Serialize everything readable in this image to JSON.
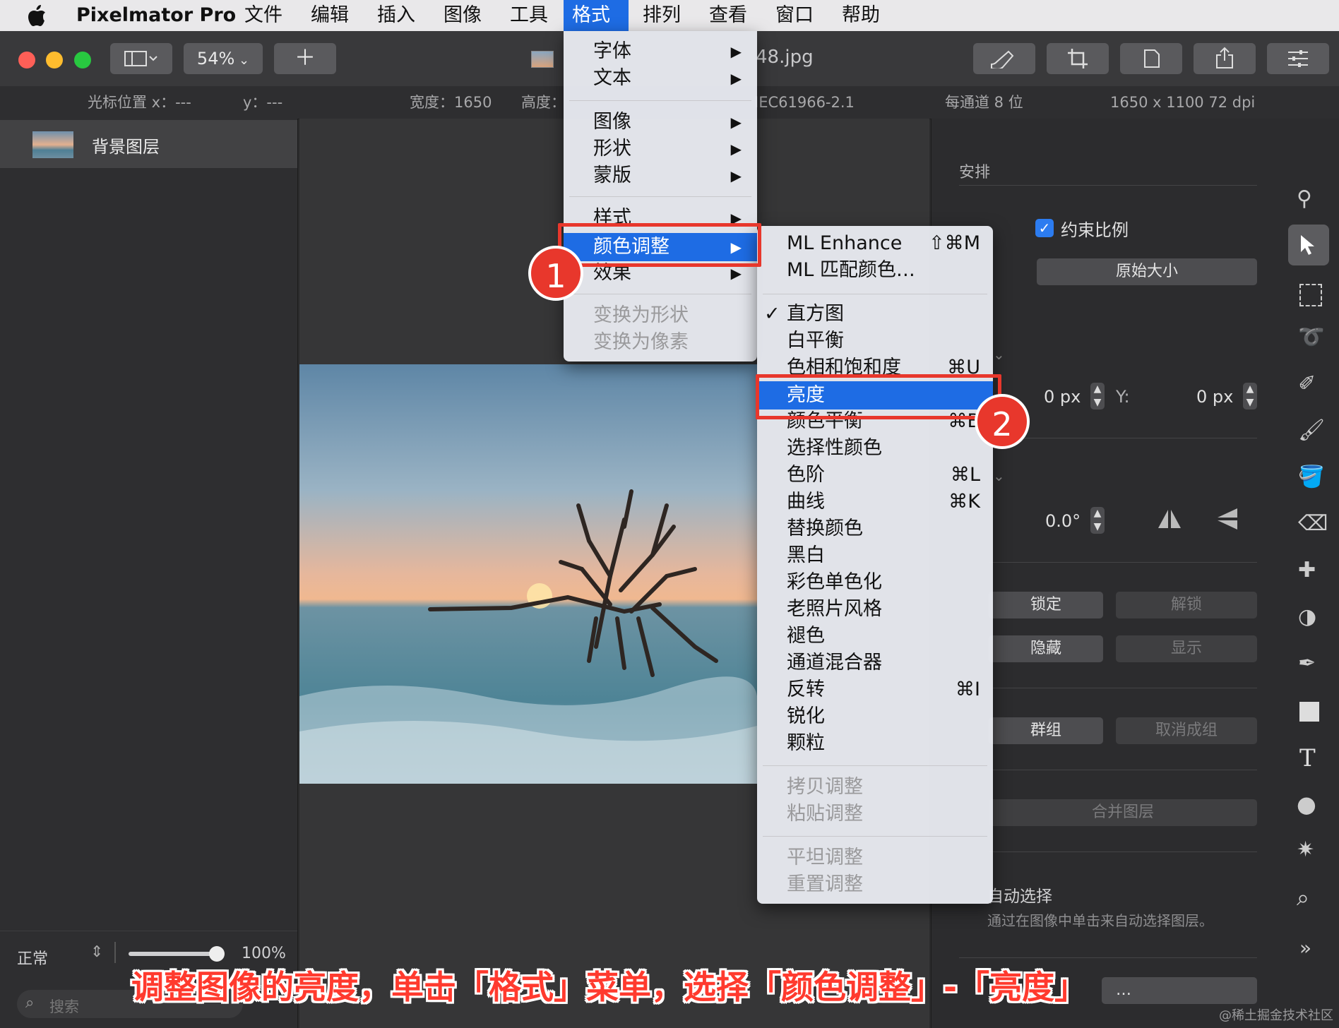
{
  "menubar": {
    "app_name": "Pixelmator Pro",
    "items": [
      "文件",
      "编辑",
      "插入",
      "图像",
      "工具",
      "格式",
      "排列",
      "查看",
      "窗口",
      "帮助"
    ],
    "active_item": "格式"
  },
  "toolbar": {
    "zoom": "54%",
    "file_name_partial": "48.jpg"
  },
  "infobar": {
    "cursor_x_label": "光标位置 x：---",
    "cursor_y_label": "y：---",
    "width_label": "宽度：1650",
    "height_label": "高度：",
    "color_profile": "IEC61966-2.1",
    "bit_depth": "每通道 8 位",
    "dimensions": "1650 x 1100 72 dpi"
  },
  "layers": {
    "layer_name": "背景图层",
    "blend_mode": "正常",
    "opacity": "100%",
    "search_placeholder": "搜索"
  },
  "format_menu": {
    "items": [
      {
        "label": "字体",
        "submenu": true
      },
      {
        "label": "文本",
        "submenu": true
      },
      {
        "label": "图像",
        "submenu": true
      },
      {
        "label": "形状",
        "submenu": true
      },
      {
        "label": "蒙版",
        "submenu": true
      },
      {
        "label": "样式",
        "submenu": true
      },
      {
        "label": "颜色调整",
        "submenu": true,
        "highlighted": true
      },
      {
        "label": "效果",
        "submenu": true
      },
      {
        "label": "变换为形状",
        "disabled": true
      },
      {
        "label": "变换为像素",
        "disabled": true
      }
    ]
  },
  "color_menu": {
    "items": [
      {
        "label": "ML Enhance",
        "shortcut": "⇧⌘M"
      },
      {
        "label": "ML 匹配颜色…",
        "shortcut": ""
      },
      {
        "label": "直方图",
        "shortcut": "",
        "checked": true
      },
      {
        "label": "白平衡",
        "shortcut": ""
      },
      {
        "label": "色相和饱和度",
        "shortcut": "⌘U"
      },
      {
        "label": "亮度",
        "shortcut": "",
        "highlighted": true
      },
      {
        "label": "颜色平衡",
        "shortcut": "⌘B"
      },
      {
        "label": "选择性颜色",
        "shortcut": ""
      },
      {
        "label": "色阶",
        "shortcut": "⌘L"
      },
      {
        "label": "曲线",
        "shortcut": "⌘K"
      },
      {
        "label": "替换颜色",
        "shortcut": ""
      },
      {
        "label": "黑白",
        "shortcut": ""
      },
      {
        "label": "彩色单色化",
        "shortcut": ""
      },
      {
        "label": "老照片风格",
        "shortcut": ""
      },
      {
        "label": "褪色",
        "shortcut": ""
      },
      {
        "label": "通道混合器",
        "shortcut": ""
      },
      {
        "label": "反转",
        "shortcut": "⌘I"
      },
      {
        "label": "锐化",
        "shortcut": ""
      },
      {
        "label": "颗粒",
        "shortcut": ""
      },
      {
        "label": "拷贝调整",
        "disabled": true
      },
      {
        "label": "粘贴调整",
        "disabled": true
      },
      {
        "label": "平坦调整",
        "disabled": true
      },
      {
        "label": "重置调整",
        "disabled": true
      }
    ]
  },
  "arrange_panel": {
    "title": "安排",
    "constrain_label": "约束比例",
    "original_size_button": "原始大小",
    "x_value": "0 px",
    "y_label": "Y:",
    "y_value": "0 px",
    "rotation": "0.0°",
    "lock_button": "锁定",
    "unlock_button": "解锁",
    "hide_button": "隐藏",
    "show_button": "显示",
    "group_button": "群组",
    "ungroup_button": "取消成组",
    "merge_button": "合并图层",
    "auto_select_label": "自动选择",
    "auto_select_desc": "通过在图像中单击来自动选择图层。",
    "bottom_button_partial": "…"
  },
  "annotations": {
    "badge1": "1",
    "badge2": "2",
    "caption": "调整图像的亮度，单击「格式」菜单，选择「颜色调整」-「亮度」",
    "watermark": "@稀土掘金技术社区"
  },
  "colors": {
    "accent": "#1e6ce4",
    "annotation_red": "#e8372c"
  }
}
